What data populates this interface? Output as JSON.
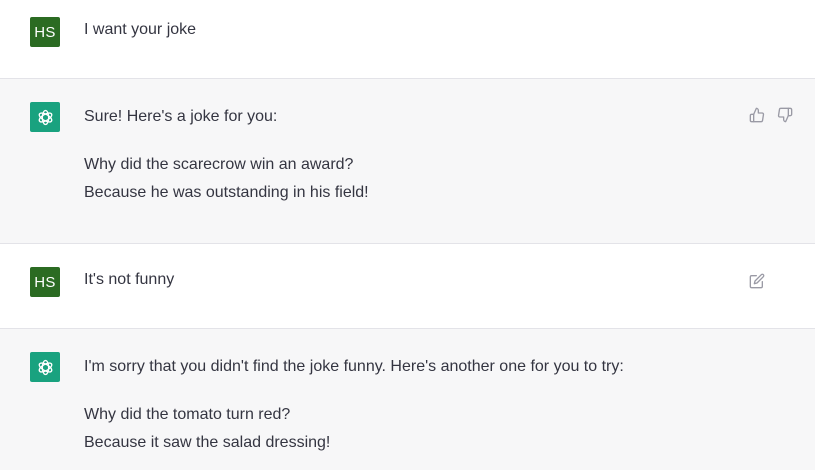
{
  "conversation": [
    {
      "role": "user",
      "avatar_initials": "HS",
      "text": "I want your joke"
    },
    {
      "role": "assistant",
      "intro": "Sure! Here's a joke for you:",
      "lines": [
        "Why did the scarecrow win an award?",
        "Because he was outstanding in his field!"
      ],
      "actions": [
        "thumbs-up-icon",
        "thumbs-down-icon"
      ]
    },
    {
      "role": "user",
      "avatar_initials": "HS",
      "text": "It's not funny",
      "actions": [
        "edit-icon"
      ]
    },
    {
      "role": "assistant",
      "intro": "I'm sorry that you didn't find the joke funny. Here's another one for you to try:",
      "lines": [
        "Why did the tomato turn red?",
        "Because it saw the salad dressing!"
      ]
    }
  ],
  "colors": {
    "user_avatar": "#2b6b22",
    "assistant_avatar": "#19a27f",
    "assistant_background": "#f7f7f8",
    "divider": "#e3e3e8",
    "text": "#343541",
    "icon": "#9a9aa5"
  }
}
